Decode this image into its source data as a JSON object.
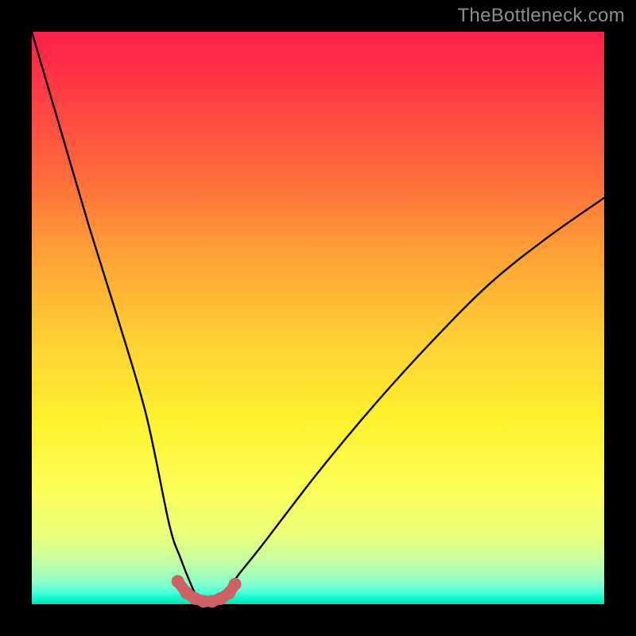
{
  "watermark": "TheBottleneck.com",
  "chart_data": {
    "type": "line",
    "title": "",
    "xlabel": "",
    "ylabel": "",
    "xlim": [
      0,
      100
    ],
    "ylim": [
      0,
      100
    ],
    "background_gradient": {
      "top_color": "#ff1f4b",
      "bottom_color": "#07e0b0",
      "meaning": "red=high bottleneck, green=low bottleneck"
    },
    "series": [
      {
        "name": "bottleneck-curve",
        "x": [
          0,
          5,
          10,
          15,
          20,
          24,
          26,
          28,
          29,
          30,
          31,
          32,
          34,
          36,
          40,
          50,
          60,
          70,
          80,
          90,
          100
        ],
        "values": [
          100,
          83,
          66,
          50,
          33,
          14,
          8,
          3,
          1,
          0,
          0,
          1,
          2,
          5,
          10,
          23,
          35,
          46,
          56,
          64,
          71
        ]
      }
    ],
    "markers": {
      "name": "optimal-range",
      "color": "#cc6262",
      "points_x": [
        25.5,
        27.0,
        28.5,
        30.0,
        31.5,
        33.0,
        34.5,
        35.5
      ],
      "points_values": [
        4.0,
        2.0,
        1.0,
        0.5,
        0.5,
        1.0,
        2.0,
        3.5
      ]
    }
  }
}
